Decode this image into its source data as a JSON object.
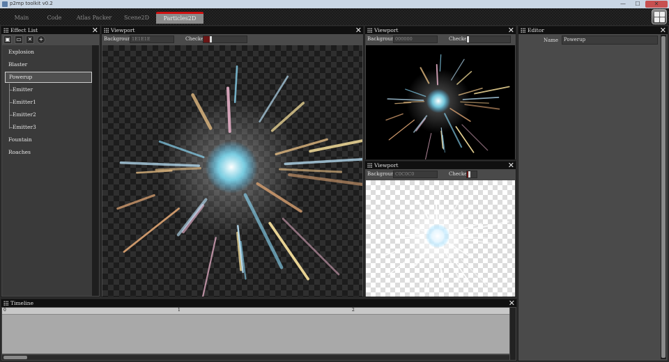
{
  "window": {
    "title": "p2mp toolkit v0.2",
    "minimize": "—",
    "maximize": "☐",
    "close": "✕"
  },
  "tabs": [
    {
      "label": "Main"
    },
    {
      "label": "Code"
    },
    {
      "label": "Atlas Packer"
    },
    {
      "label": "Scene2D"
    },
    {
      "label": "Particles2D",
      "active": true
    }
  ],
  "effect_list": {
    "title": "Effect List",
    "items": [
      {
        "label": "Explosion"
      },
      {
        "label": "Blaster"
      },
      {
        "label": "Powerup",
        "selected": true
      },
      {
        "label": "Emitter"
      },
      {
        "label": "Emitter1"
      },
      {
        "label": "Emitter2"
      },
      {
        "label": "Emitter3"
      },
      {
        "label": "Fountain"
      },
      {
        "label": "Roaches"
      }
    ]
  },
  "viewport_main": {
    "title": "Viewport",
    "background_label": "Background",
    "background_value": "1E1E1E",
    "checker_label": "Checker",
    "checker_level": 0.15
  },
  "viewport_black": {
    "title": "Viewport",
    "background_label": "Background",
    "background_value": "000000",
    "checker_label": "Checker",
    "checker_level": 0.0
  },
  "viewport_white": {
    "title": "Viewport",
    "background_label": "Background",
    "background_value": "C0C0C0",
    "checker_label": "Checker",
    "checker_level": 0.15
  },
  "editor": {
    "title": "Editor",
    "name_label": "Name",
    "name_value": "Powerup"
  },
  "timeline": {
    "title": "Timeline",
    "ticks": [
      "0",
      "1",
      "2"
    ]
  },
  "colors": {
    "accent": "#d01010",
    "panel": "#4a4a4a",
    "header": "#101010"
  },
  "icons": [
    "save-icon",
    "folder-open-icon",
    "delete-icon",
    "add-icon",
    "close-icon",
    "grip-icon",
    "grid-icon"
  ]
}
